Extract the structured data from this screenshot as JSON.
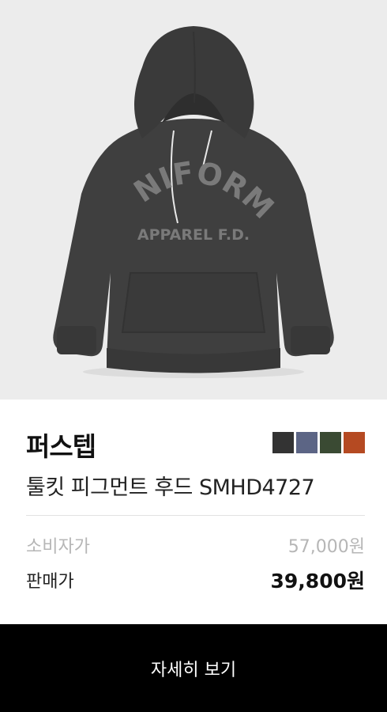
{
  "product": {
    "image_alt_icon": "hoodie-image",
    "graphic_text_top": "UNIFORM",
    "graphic_text_bottom": "APPAREL F.D.",
    "brand": "퍼스텝",
    "name": "툴킷 피그먼트 후드 SMHD4727",
    "color_swatches": [
      {
        "name": "charcoal",
        "color": "#333333"
      },
      {
        "name": "slate-blue",
        "color": "#5c6585"
      },
      {
        "name": "olive",
        "color": "#3a4a33"
      },
      {
        "name": "rust",
        "color": "#b54a22"
      }
    ]
  },
  "pricing": {
    "msrp_label": "소비자가",
    "msrp_value": "57,000원",
    "sale_label": "판매가",
    "sale_value": "39,800원"
  },
  "actions": {
    "detail_label": "자세히 보기"
  },
  "colors": {
    "image_background": "#ececec",
    "hoodie": "#3f3f3f",
    "button_background": "#000000"
  }
}
